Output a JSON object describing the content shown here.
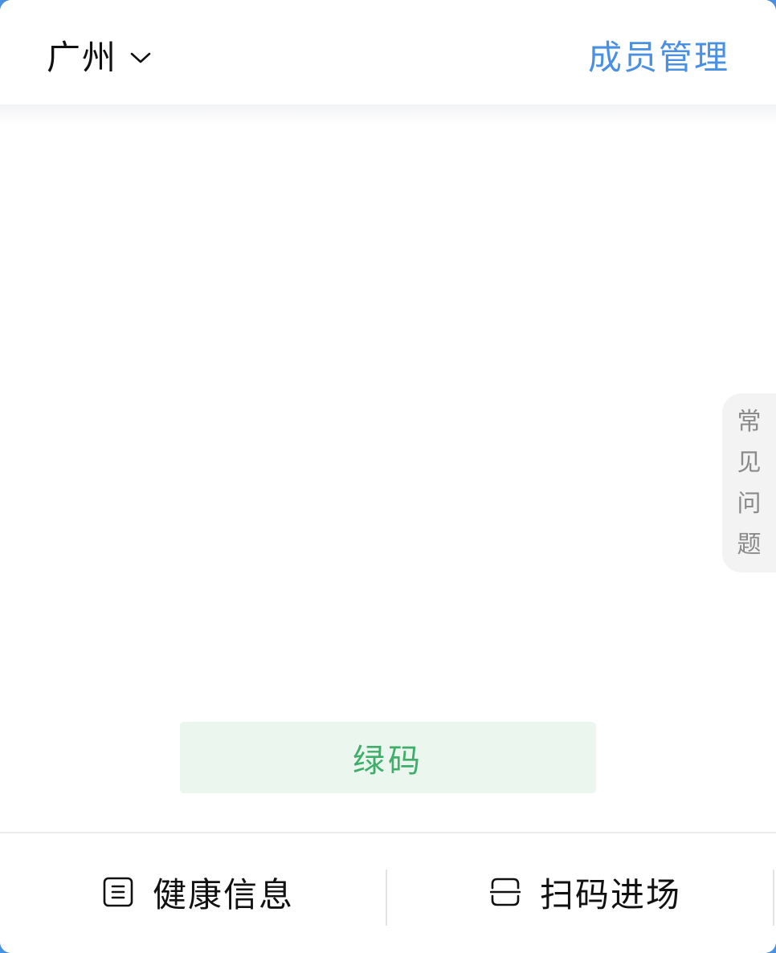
{
  "header": {
    "city": "广州",
    "city_dropdown_icon": "chevron-down-icon",
    "member_management": "成员管理"
  },
  "side_tab": {
    "chars": [
      "常",
      "见",
      "问",
      "题"
    ]
  },
  "status": {
    "label": "绿码"
  },
  "bottom_nav": {
    "health_info": {
      "label": "健康信息",
      "icon": "document-icon"
    },
    "scan_entry": {
      "label": "扫码进场",
      "icon": "scan-icon"
    }
  },
  "colors": {
    "accent_blue": "#4a90e2",
    "green_code": "#3fae6a",
    "green_code_bg": "#ebf6ee"
  }
}
